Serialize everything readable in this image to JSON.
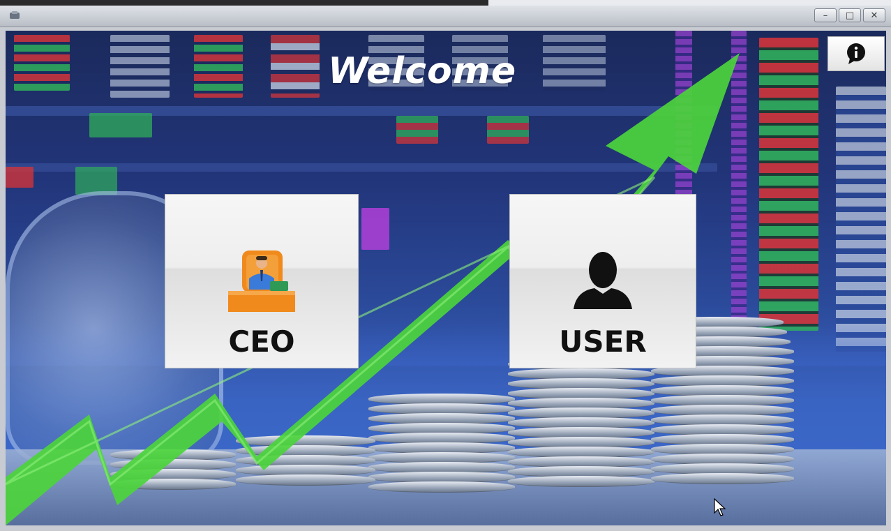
{
  "window": {
    "controls": {
      "minimize": "–",
      "maximize": "□",
      "close": "✕"
    }
  },
  "main": {
    "title": "Welcome",
    "tiles": [
      {
        "label": "CEO",
        "icon": "ceo-desk-icon"
      },
      {
        "label": "USER",
        "icon": "user-silhouette-icon"
      }
    ],
    "info_button_icon": "info-chat-icon"
  },
  "colors": {
    "arrow_green": "#4cd43c",
    "tile_bg": "#f2f2f2",
    "welcome_text": "#ffffff"
  }
}
